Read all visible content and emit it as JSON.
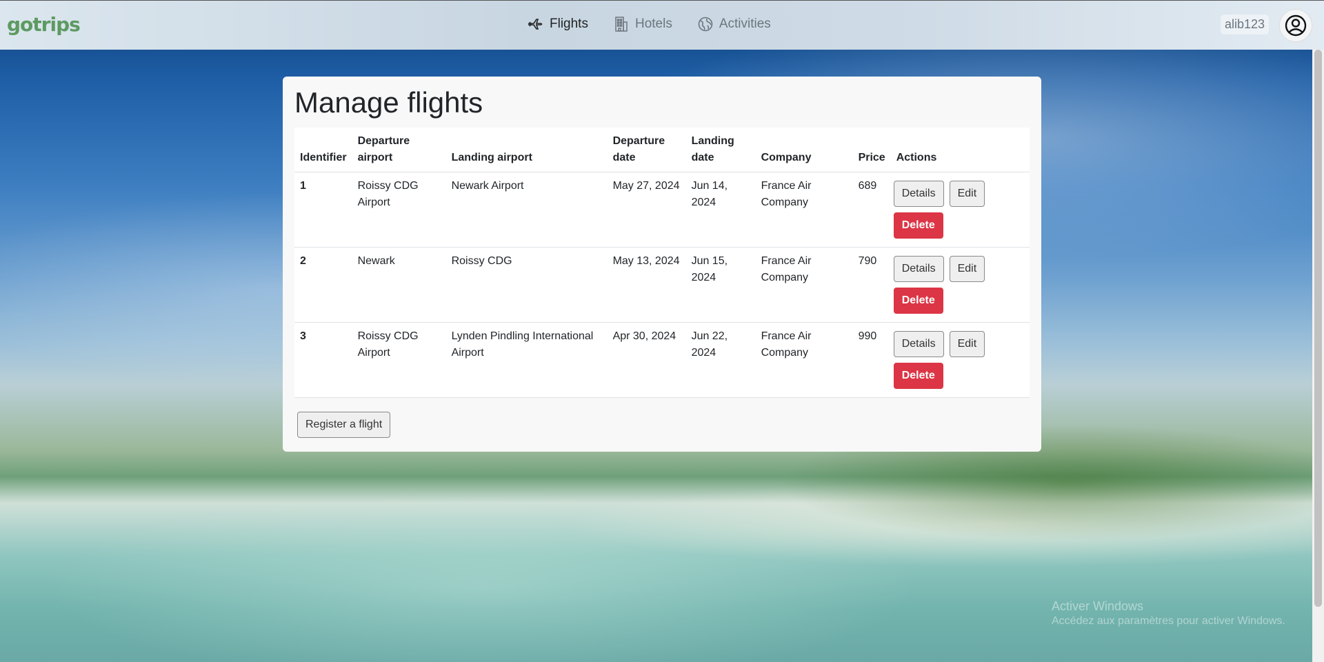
{
  "app": {
    "logo": "gotrips"
  },
  "nav": {
    "flights": "Flights",
    "hotels": "Hotels",
    "activities": "Activities"
  },
  "user": {
    "name": "alib123"
  },
  "page": {
    "title": "Manage flights"
  },
  "table": {
    "headers": {
      "identifier": "Identifier",
      "departure_airport": "Departure airport",
      "landing_airport": "Landing airport",
      "departure_date": "Departure date",
      "landing_date": "Landing date",
      "company": "Company",
      "price": "Price",
      "actions": "Actions"
    },
    "rows": [
      {
        "id": "1",
        "departure_airport": "Roissy CDG Airport",
        "landing_airport": "Newark Airport",
        "departure_date": "May 27, 2024",
        "landing_date": "Jun 14, 2024",
        "company": "France Air Company",
        "price": "689"
      },
      {
        "id": "2",
        "departure_airport": "Newark",
        "landing_airport": "Roissy CDG",
        "departure_date": "May 13, 2024",
        "landing_date": "Jun 15, 2024",
        "company": "France Air Company",
        "price": "790"
      },
      {
        "id": "3",
        "departure_airport": "Roissy CDG Airport",
        "landing_airport": "Lynden Pindling International Airport",
        "departure_date": "Apr 30, 2024",
        "landing_date": "Jun 22, 2024",
        "company": "France Air Company",
        "price": "990"
      }
    ]
  },
  "buttons": {
    "details": "Details",
    "edit": "Edit",
    "delete": "Delete",
    "register": "Register a flight"
  },
  "watermark": {
    "line1": "Activer Windows",
    "line2": "Accédez aux paramètres pour activer Windows."
  },
  "colors": {
    "logo": "#5d9a61",
    "danger": "#dc3545"
  }
}
